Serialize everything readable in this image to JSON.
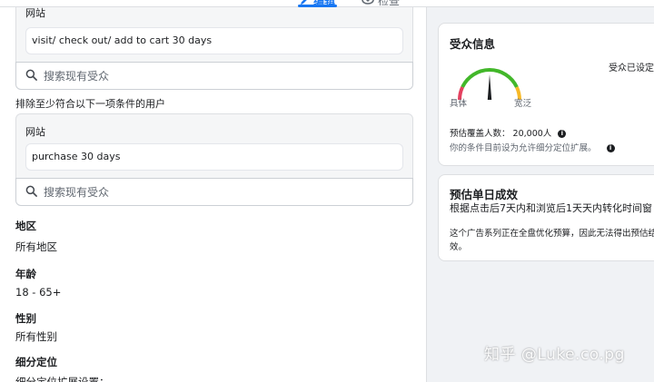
{
  "tabs": {
    "edit_label": "编辑",
    "review_label": "检查"
  },
  "include_group": {
    "label": "网站",
    "value": "visit/ check out/ add to cart 30 days",
    "search_placeholder": "搜索现有受众"
  },
  "exclude_group": {
    "note": "排除至少符合以下一项条件的用户",
    "label": "网站",
    "value": "purchase 30 days",
    "search_placeholder": "搜索现有受众"
  },
  "targeting": {
    "location_title": "地区",
    "location_value": "所有地区",
    "age_title": "年龄",
    "age_value": "18 - 65+",
    "gender_title": "性别",
    "gender_value": "所有性别",
    "detailed_title": "细分定位",
    "detailed_sub": "细分定位扩展设置："
  },
  "audience_card": {
    "title": "受众信息",
    "status": "受众已设定",
    "gauge_left": "具体",
    "gauge_right": "宽泛",
    "gauge_level": 0.5,
    "reach_label": "预估覆盖人数：",
    "reach_value": "20,000人",
    "expansion_note": "你的条件目前设为允许细分定位扩展。"
  },
  "results_card": {
    "title": "预估单日成效",
    "subtitle": "根据点击后7天内和浏览后1天天内转化时间窗",
    "note_line1": "这个广告系列正在全盘优化预算，因此无法得出预估结",
    "note_line2": "效。"
  },
  "watermark": "知乎 @Luke.co.pg",
  "colors": {
    "accent": "#1877f2",
    "gauge_red": "#e4405f",
    "gauge_yellow": "#f7b928",
    "gauge_green": "#42b72a"
  }
}
